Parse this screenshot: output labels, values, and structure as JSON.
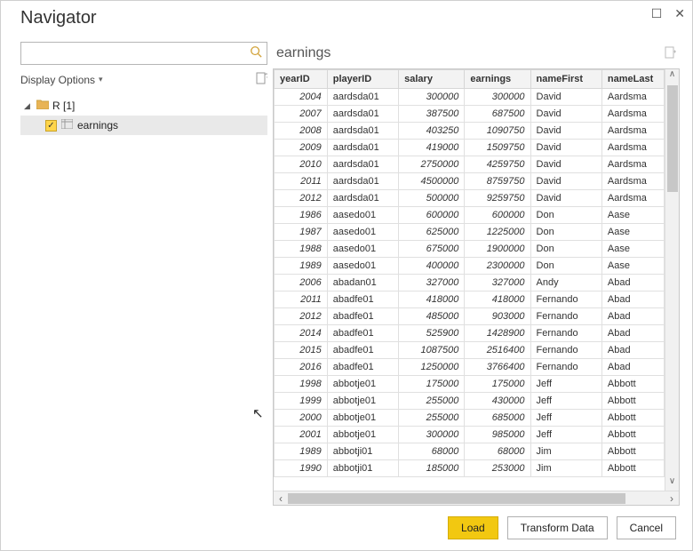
{
  "window": {
    "title": "Navigator"
  },
  "search": {
    "value": "",
    "placeholder": ""
  },
  "displayOptions": {
    "label": "Display Options"
  },
  "tree": {
    "root": {
      "label": "R [1]"
    },
    "items": [
      {
        "label": "earnings",
        "checked": true
      }
    ]
  },
  "preview": {
    "title": "earnings",
    "columns": [
      "yearID",
      "playerID",
      "salary",
      "earnings",
      "nameFirst",
      "nameLast"
    ],
    "columnTypes": [
      "num",
      "txt",
      "num",
      "num",
      "txt",
      "txt"
    ],
    "rows": [
      [
        "2004",
        "aardsda01",
        "300000",
        "300000",
        "David",
        "Aardsma"
      ],
      [
        "2007",
        "aardsda01",
        "387500",
        "687500",
        "David",
        "Aardsma"
      ],
      [
        "2008",
        "aardsda01",
        "403250",
        "1090750",
        "David",
        "Aardsma"
      ],
      [
        "2009",
        "aardsda01",
        "419000",
        "1509750",
        "David",
        "Aardsma"
      ],
      [
        "2010",
        "aardsda01",
        "2750000",
        "4259750",
        "David",
        "Aardsma"
      ],
      [
        "2011",
        "aardsda01",
        "4500000",
        "8759750",
        "David",
        "Aardsma"
      ],
      [
        "2012",
        "aardsda01",
        "500000",
        "9259750",
        "David",
        "Aardsma"
      ],
      [
        "1986",
        "aasedo01",
        "600000",
        "600000",
        "Don",
        "Aase"
      ],
      [
        "1987",
        "aasedo01",
        "625000",
        "1225000",
        "Don",
        "Aase"
      ],
      [
        "1988",
        "aasedo01",
        "675000",
        "1900000",
        "Don",
        "Aase"
      ],
      [
        "1989",
        "aasedo01",
        "400000",
        "2300000",
        "Don",
        "Aase"
      ],
      [
        "2006",
        "abadan01",
        "327000",
        "327000",
        "Andy",
        "Abad"
      ],
      [
        "2011",
        "abadfe01",
        "418000",
        "418000",
        "Fernando",
        "Abad"
      ],
      [
        "2012",
        "abadfe01",
        "485000",
        "903000",
        "Fernando",
        "Abad"
      ],
      [
        "2014",
        "abadfe01",
        "525900",
        "1428900",
        "Fernando",
        "Abad"
      ],
      [
        "2015",
        "abadfe01",
        "1087500",
        "2516400",
        "Fernando",
        "Abad"
      ],
      [
        "2016",
        "abadfe01",
        "1250000",
        "3766400",
        "Fernando",
        "Abad"
      ],
      [
        "1998",
        "abbotje01",
        "175000",
        "175000",
        "Jeff",
        "Abbott"
      ],
      [
        "1999",
        "abbotje01",
        "255000",
        "430000",
        "Jeff",
        "Abbott"
      ],
      [
        "2000",
        "abbotje01",
        "255000",
        "685000",
        "Jeff",
        "Abbott"
      ],
      [
        "2001",
        "abbotje01",
        "300000",
        "985000",
        "Jeff",
        "Abbott"
      ],
      [
        "1989",
        "abbotji01",
        "68000",
        "68000",
        "Jim",
        "Abbott"
      ],
      [
        "1990",
        "abbotji01",
        "185000",
        "253000",
        "Jim",
        "Abbott"
      ]
    ]
  },
  "footer": {
    "load": "Load",
    "transform": "Transform Data",
    "cancel": "Cancel"
  },
  "scroll": {
    "vThumbTop": 18,
    "vThumbHeight": 120,
    "hThumbLeft": 0,
    "hThumbWidth": 380
  }
}
